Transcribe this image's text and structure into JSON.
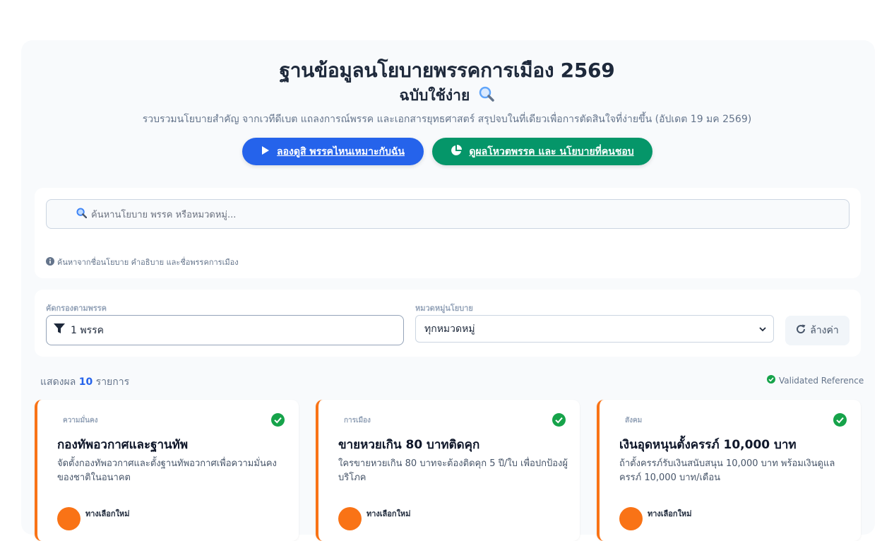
{
  "header": {
    "title": "ฐานข้อมูลนโยบายพรรคการเมือง 2569",
    "subtitle": "ฉบับใช้ง่าย",
    "description": "รวบรวมนโยบายสำคัญ จากเวทีดีเบต แถลงการณ์พรรค และเอกสารยุทธศาสตร์ สรุปจบในที่เดียวเพื่อการตัดสินใจที่ง่ายขึ้น (อัปเดต 19 มค 2569)"
  },
  "actions": {
    "quiz_label": "ลองดูสิ พรรคไหนเหมาะกับฉัน",
    "votes_label": "ดูผลโหวตพรรค และ นโยบายที่คนชอบ"
  },
  "search": {
    "placeholder": "ค้นหานโยบาย พรรค หรือหมวดหมู่...",
    "hint": "ค้นหาจากชื่อนโยบาย คำอธิบาย และชื่อพรรคการเมือง"
  },
  "filters": {
    "party_label": "คัดกรองตามพรรค",
    "party_value": "1 พรรค",
    "category_label": "หมวดหมู่นโยบาย",
    "category_value": "ทุกหมวดหมู่",
    "clear_label": "ล้างค่า"
  },
  "results": {
    "prefix": "แสดงผล",
    "count": "10",
    "suffix": "รายการ",
    "validated": "Validated Reference"
  },
  "policies": [
    {
      "category": "ความมั่นคง",
      "title": "กองทัพอวกาศและฐานทัพ",
      "description": "จัดตั้งกองทัพอวกาศและตั้งฐานทัพอวกาศเพื่อความมั่นคงของชาติในอนาคต",
      "party": "ทางเลือกใหม่"
    },
    {
      "category": "การเมือง",
      "title": "ขายหวยเกิน 80 บาทติดคุก",
      "description": "ใครขายหวยเกิน 80 บาทจะต้องติดคุก 5 ปี/ใบ เพื่อปกป้องผู้บริโภค",
      "party": "ทางเลือกใหม่"
    },
    {
      "category": "สังคม",
      "title": "เงินอุดหนุนตั้งครรภ์ 10,000 บาท",
      "description": "ถ้าตั้งครรภ์รับเงินสนับสนุน 10,000 บาท พร้อมเงินดูแลครรภ์ 10,000 บาท/เดือน",
      "party": "ทางเลือกใหม่"
    }
  ],
  "colors": {
    "primary_blue": "#2563eb",
    "primary_green": "#059669",
    "accent_orange": "#f97316",
    "check_green": "#16a34a"
  },
  "icons": {
    "subtitle": "magnifier-icon",
    "quiz": "play-icon",
    "votes": "pie-chart-icon",
    "search": "search-icon",
    "hint": "info-icon",
    "party_filter": "filter-icon",
    "category_select": "chevron-down-icon",
    "clear": "refresh-icon",
    "validated": "check-circle-icon"
  }
}
